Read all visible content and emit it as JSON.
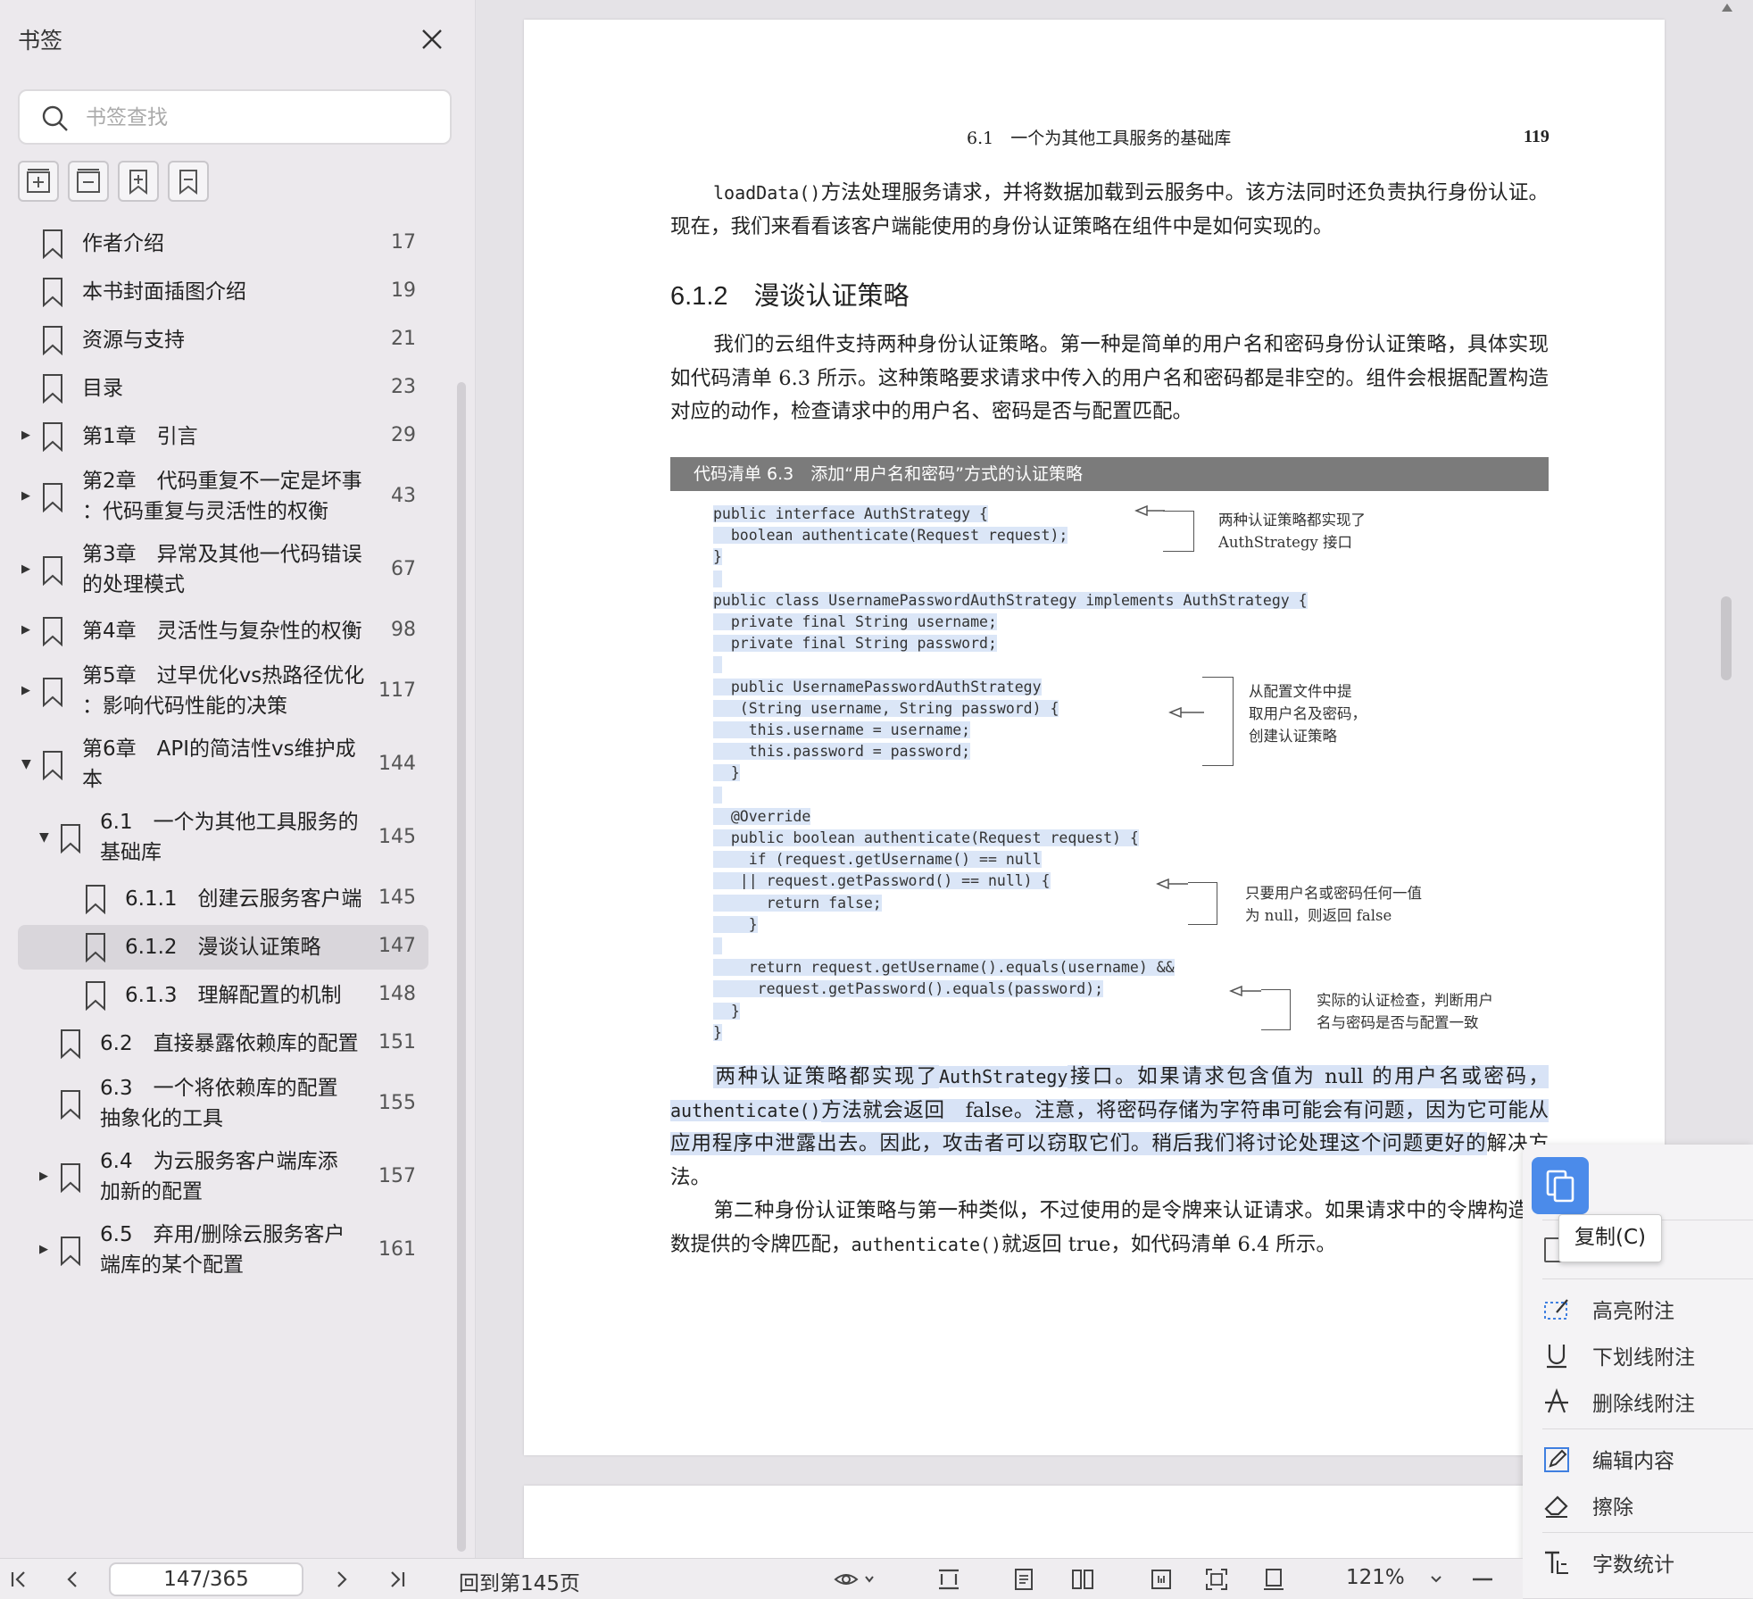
{
  "sidebar": {
    "title": "书签",
    "search_placeholder": "书签查找",
    "items": [
      {
        "label": "作者介绍",
        "page": "17",
        "level": 0,
        "arrow": ""
      },
      {
        "label": "本书封面插图介绍",
        "page": "19",
        "level": 0,
        "arrow": ""
      },
      {
        "label": "资源与支持",
        "page": "21",
        "level": 0,
        "arrow": ""
      },
      {
        "label": "目录",
        "page": "23",
        "level": 0,
        "arrow": ""
      },
      {
        "label": "第1章　引言",
        "page": "29",
        "level": 0,
        "arrow": "right"
      },
      {
        "label": "第2章　代码重复不一定是坏事",
        "label2": "：代码重复与灵活性的权衡",
        "page": "43",
        "level": 0,
        "arrow": "right"
      },
      {
        "label": "第3章　异常及其他一代码错误",
        "label2": "的处理模式",
        "page": "67",
        "level": 0,
        "arrow": "right"
      },
      {
        "label": "第4章　灵活性与复杂性的权衡",
        "page": "98",
        "level": 0,
        "arrow": "right"
      },
      {
        "label": "第5章　过早优化vs热路径优化",
        "label2": "：影响代码性能的决策",
        "page": "117",
        "level": 0,
        "arrow": "right"
      },
      {
        "label": "第6章　API的简洁性vs维护成",
        "label2": "本",
        "page": "144",
        "level": 0,
        "arrow": "down"
      },
      {
        "label": "6.1　一个为其他工具服务的",
        "label2": "基础库",
        "page": "145",
        "level": 1,
        "arrow": "down"
      },
      {
        "label": "6.1.1　创建云服务客户端",
        "page": "145",
        "level": 2,
        "arrow": ""
      },
      {
        "label": "6.1.2　漫谈认证策略",
        "page": "147",
        "level": 2,
        "arrow": "",
        "selected": true
      },
      {
        "label": "6.1.3　理解配置的机制",
        "page": "148",
        "level": 2,
        "arrow": ""
      },
      {
        "label": "6.2　直接暴露依赖库的配置",
        "page": "151",
        "level": 1,
        "arrow": ""
      },
      {
        "label": "6.3　一个将依赖库的配置",
        "label2": "抽象化的工具",
        "page": "155",
        "level": 1,
        "arrow": ""
      },
      {
        "label": "6.4　为云服务客户端库添",
        "label2": "加新的配置",
        "page": "157",
        "level": 1,
        "arrow": "right"
      },
      {
        "label": "6.5　弃用/删除云服务客户",
        "label2": "端库的某个配置",
        "page": "161",
        "level": 1,
        "arrow": "right"
      }
    ]
  },
  "page": {
    "running_head": "6.1　一个为其他工具服务的基础库",
    "page_number": "119",
    "p1_code": "loadData()",
    "p1_text": "方法处理服务请求，并将数据加载到云服务中。该方法同时还负责执行身份认证。现在，我们来看看该客户端能使用的身份认证策略在组件中是如何实现的。",
    "section_heading": "6.1.2　漫谈认证策略",
    "p2": "我们的云组件支持两种身份认证策略。第一种是简单的用户名和密码身份认证策略，具体实现如代码清单 6.3 所示。这种策略要求请求中传入的用户名和密码都是非空的。组件会根据配置构造对应的动作，检查请求中的用户名、密码是否与配置匹配。",
    "listing_title": "代码清单 6.3　添加“用户名和密码”方式的认证策略",
    "code_lines": [
      "public interface AuthStrategy {",
      "  boolean authenticate(Request request);",
      "}",
      "",
      "public class UsernamePasswordAuthStrategy implements AuthStrategy {",
      "  private final String username;",
      "  private final String password;",
      "",
      "  public UsernamePasswordAuthStrategy",
      "   (String username, String password) {",
      "    this.username = username;",
      "    this.password = password;",
      "  }",
      "",
      "  @Override",
      "  public boolean authenticate(Request request) {",
      "    if (request.getUsername() == null",
      "   || request.getPassword() == null) {",
      "      return false;",
      "    }",
      "",
      "    return request.getUsername().equals(username) &&",
      "     request.getPassword().equals(password);",
      "  }",
      "}"
    ],
    "annotations": [
      {
        "line1": "两种认证策略都实现了",
        "line2": "AuthStrategy 接口"
      },
      {
        "line1": "从配置文件中提",
        "line2": "取用户名及密码，",
        "line3": "创建认证策略"
      },
      {
        "line1": "只要用户名或密码任何一值",
        "line2": "为 null，则返回 false"
      },
      {
        "line1": "实际的认证检查，判断用户",
        "line2": "名与密码是否与配置一致"
      }
    ],
    "p3_a": "两种认证策略都实现了",
    "p3_code1": "AuthStrategy",
    "p3_b": "接口。如果请求包含值为 null 的用户名或密码，",
    "p3_code2": "authenticate()",
    "p3_c": "方法就会返回　false。注意，将密码存储为字符串可能会有问题，因为它可能从应用程序中泄露出去。因此，攻击者可以窃取它们。稍后我们将讨论处理这个问题更好的",
    "p3_d": "解决方法。",
    "p4_a": "第二种身份认证策略与第一种类似，不过使用的是令牌来认证请求。如果请求中的令牌",
    "p4_b": "构造函数提供的令牌匹配，",
    "p4_code": "authenticate()",
    "p4_c": "就返回 true，如代码清单 6.4 所示。"
  },
  "context_menu": {
    "tooltip": "复制(C)",
    "items": [
      "高亮附注",
      "下划线附注",
      "删除线附注",
      "编辑内容",
      "擦除",
      "字数统计"
    ]
  },
  "bottombar": {
    "page_indicator": "147/365",
    "back_to": "回到第145页",
    "zoom": "121%"
  },
  "colors": {
    "selection": "#dbe6f7",
    "accent": "#4b8bea",
    "listing_bar": "#7b7b7b"
  }
}
